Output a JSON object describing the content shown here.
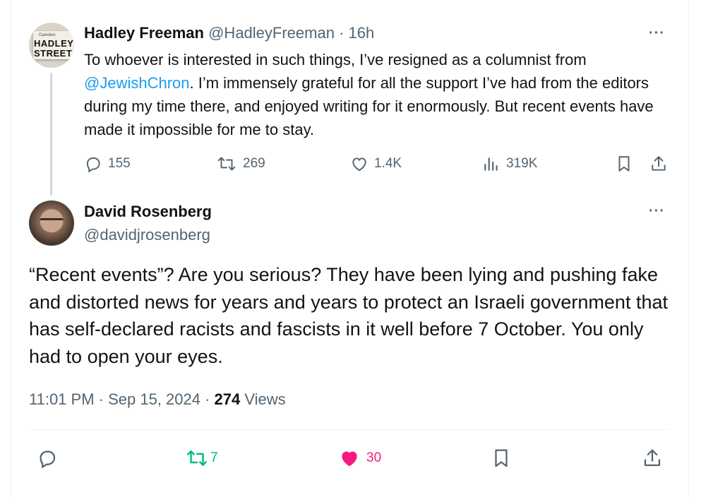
{
  "quoted_tweet": {
    "avatar_sign": {
      "line1": "Camden",
      "line2": "HADLEY",
      "line3": "STREET"
    },
    "author_name": "Hadley Freeman",
    "author_handle": "@HadleyFreeman",
    "separator": " · ",
    "time": "16h",
    "more_label": "···",
    "text_before": "To whoever is interested in such things, I’ve resigned as a columnist from ",
    "mention": "@JewishChron",
    "text_after": ". I’m immensely grateful for all the support I’ve had from the editors during my time there, and enjoyed writing for it enormously. But recent events have made it impossible for me to stay.",
    "stats": {
      "replies": "155",
      "reposts": "269",
      "likes": "1.4K",
      "views": "319K"
    }
  },
  "reply_tweet": {
    "author_name": "David Rosenberg",
    "author_handle": "@davidjrosenberg",
    "more_label": "···",
    "text": "“Recent events”? Are you serious? They have been lying and pushing fake and distorted news for years and years to protect an Israeli government that has self-declared racists and fascists in it well before 7 October. You only had to open your eyes.",
    "timestamp": "11:01 PM · Sep 15, 2024",
    "meta_sep": " · ",
    "views_count": "274",
    "views_label": " Views",
    "stats": {
      "reposts": "7",
      "likes": "30"
    }
  },
  "colors": {
    "text": "#0f1419",
    "secondary": "#536471",
    "link": "#1d9bf0",
    "repost_active": "#00ba7c",
    "like_active": "#f91880",
    "divider": "#eff3f4"
  },
  "icons": [
    "reply-icon",
    "repost-icon",
    "like-icon",
    "views-icon",
    "bookmark-icon",
    "share-icon",
    "more-icon"
  ]
}
